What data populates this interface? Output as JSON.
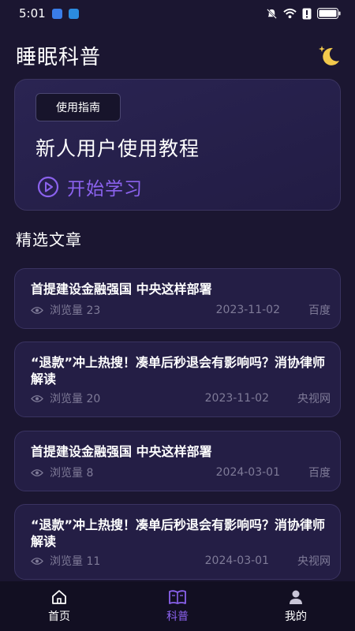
{
  "status": {
    "time": "5:01"
  },
  "header": {
    "title": "睡眠科普"
  },
  "hero": {
    "badge": "使用指南",
    "title": "新人用户使用教程",
    "action": "开始学习"
  },
  "section": {
    "title": "精选文章"
  },
  "articles": [
    {
      "title": "首提建设金融强国 中央这样部署",
      "views_label": "浏览量 23",
      "date": "2023-11-02",
      "source": "百度"
    },
    {
      "title": "“退款”冲上热搜！凑单后秒退会有影响吗？消协律师解读",
      "views_label": "浏览量 20",
      "date": "2023-11-02",
      "source": "央视网"
    },
    {
      "title": "首提建设金融强国 中央这样部署",
      "views_label": "浏览量 8",
      "date": "2024-03-01",
      "source": "百度"
    },
    {
      "title": "“退款”冲上热搜！凑单后秒退会有影响吗？消协律师解读",
      "views_label": "浏览量 11",
      "date": "2024-03-01",
      "source": "央视网"
    }
  ],
  "tabs": [
    {
      "label": "首页",
      "icon": "home-icon",
      "active": false
    },
    {
      "label": "科普",
      "icon": "book-icon",
      "active": true
    },
    {
      "label": "我的",
      "icon": "user-icon",
      "active": false
    }
  ],
  "colors": {
    "accent": "#8b62ee",
    "background": "#1b1631",
    "card": "#241e45"
  }
}
